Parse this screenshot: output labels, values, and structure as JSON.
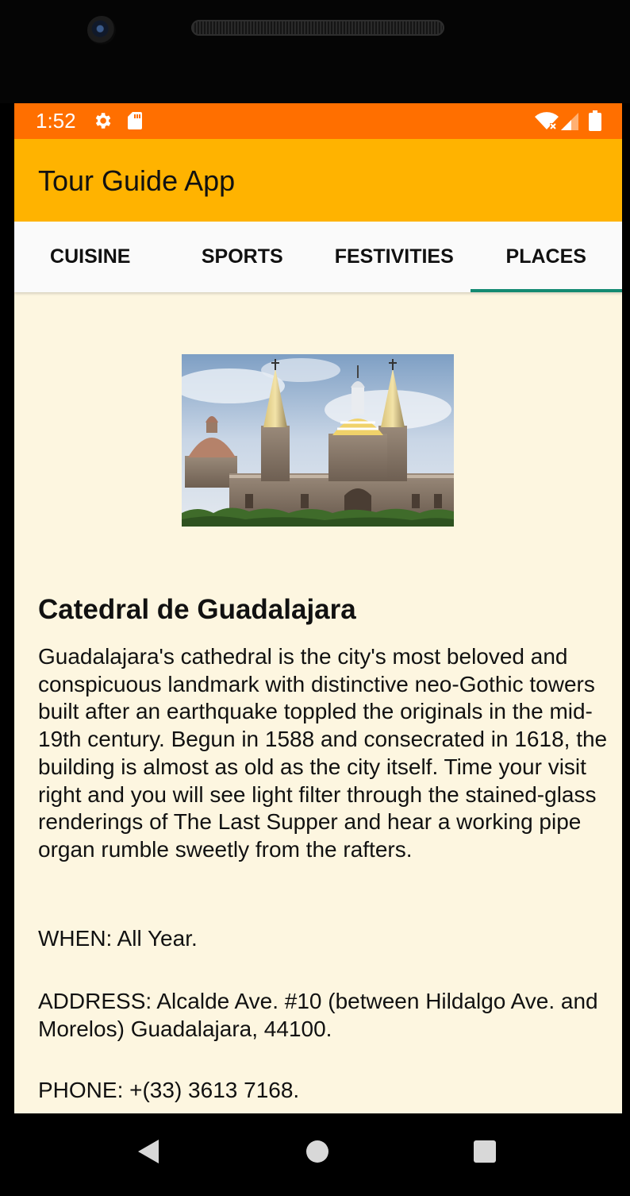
{
  "status_bar": {
    "time": "1:52",
    "icons": [
      "gear-icon",
      "sd-card-icon",
      "wifi-icon",
      "signal-icon",
      "battery-icon"
    ],
    "background_color": "#ff6f00"
  },
  "app_bar": {
    "title": "Tour Guide App",
    "background_color": "#ffb300"
  },
  "tabs": [
    {
      "label": "CUISINE",
      "selected": false
    },
    {
      "label": "SPORTS",
      "selected": false
    },
    {
      "label": "FESTIVITIES",
      "selected": false
    },
    {
      "label": "PLACES",
      "selected": true
    }
  ],
  "tab_indicator_color": "#138a72",
  "place": {
    "image": "cathedral-photo",
    "title": "Catedral de Guadalajara",
    "description": "Guadalajara's cathedral is the city's most beloved and conspicuous landmark with distinctive neo-Gothic towers built after an earthquake toppled the originals in the mid-19th century. Begun in 1588 and consecrated in 1618, the building is almost as old as the city itself. Time your visit right and you will see light filter through the stained-glass renderings of The Last Supper and hear a working pipe organ rumble sweetly from the rafters.",
    "when": "WHEN: All Year.",
    "address": "ADDRESS: Alcalde Ave. #10 (between Hildalgo Ave. and Morelos) Guadalajara, 44100.",
    "phone": "PHONE: +(33) 3613 7168."
  },
  "content_background_color": "#fdf6e0",
  "nav_bar": {
    "buttons": [
      "back-icon",
      "home-icon",
      "recents-icon"
    ]
  }
}
